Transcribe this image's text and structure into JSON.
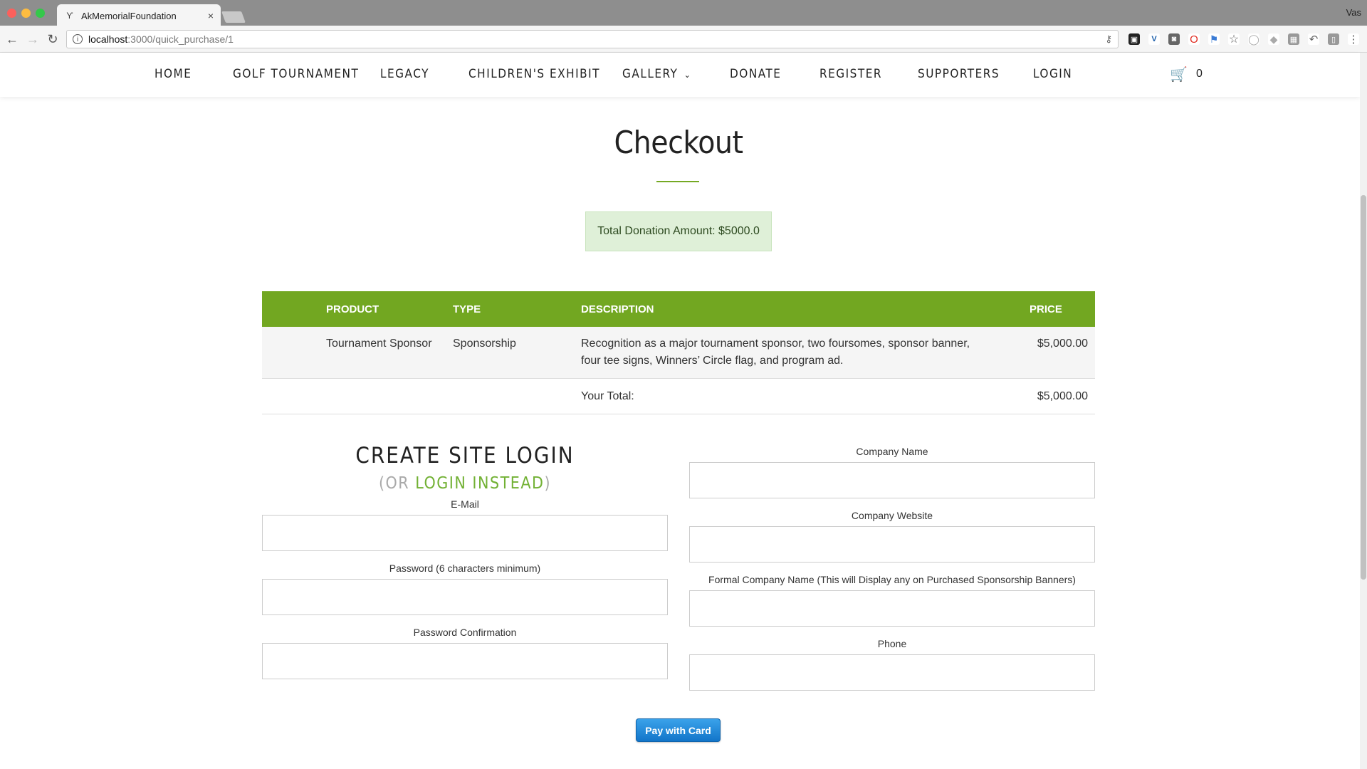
{
  "browser": {
    "tab_title": "AkMemorialFoundation",
    "tab_close": "×",
    "url_host": "localhost",
    "url_path": ":3000/quick_purchase/1",
    "profile_name": "Vas"
  },
  "nav": {
    "items": [
      "HOME",
      "GOLF TOURNAMENT",
      "LEGACY",
      "CHILDREN'S EXHIBIT",
      "GALLERY",
      "DONATE",
      "REGISTER",
      "SUPPORTERS",
      "LOGIN"
    ],
    "cart_count": "0"
  },
  "page": {
    "title": "Checkout",
    "donation_alert": "Total Donation Amount: $5000.0"
  },
  "cart_table": {
    "headers": [
      "PRODUCT",
      "TYPE",
      "DESCRIPTION",
      "PRICE"
    ],
    "rows": [
      {
        "product": "Tournament Sponsor",
        "type": "Sponsorship",
        "description": "Recognition as a major tournament sponsor, two foursomes, sponsor banner, four tee signs, Winners’ Circle flag, and program ad.",
        "price": "$5,000.00"
      }
    ],
    "total_label": "Your Total:",
    "total_value": "$5,000.00"
  },
  "login_form": {
    "heading": "CREATE SITE LOGIN",
    "or_prefix": "(OR ",
    "login_link": "LOGIN INSTEAD",
    "or_suffix": ")",
    "email_label": "E-Mail",
    "email_value": "",
    "password_label": "Password (6 characters minimum)",
    "password_value": "",
    "password_confirm_label": "Password Confirmation",
    "password_confirm_value": ""
  },
  "company_form": {
    "company_name_label": "Company Name",
    "company_name_value": "",
    "company_website_label": "Company Website",
    "company_website_value": "",
    "formal_name_label": "Formal Company Name (This will Display any on Purchased Sponsorship Banners)",
    "formal_name_value": "",
    "phone_label": "Phone",
    "phone_value": ""
  },
  "pay_button": "Pay with Card",
  "colors": {
    "accent_green": "#72a721",
    "link_green": "#72b134",
    "pay_blue": "#1e8ad8",
    "alert_bg": "#dff0d8"
  }
}
